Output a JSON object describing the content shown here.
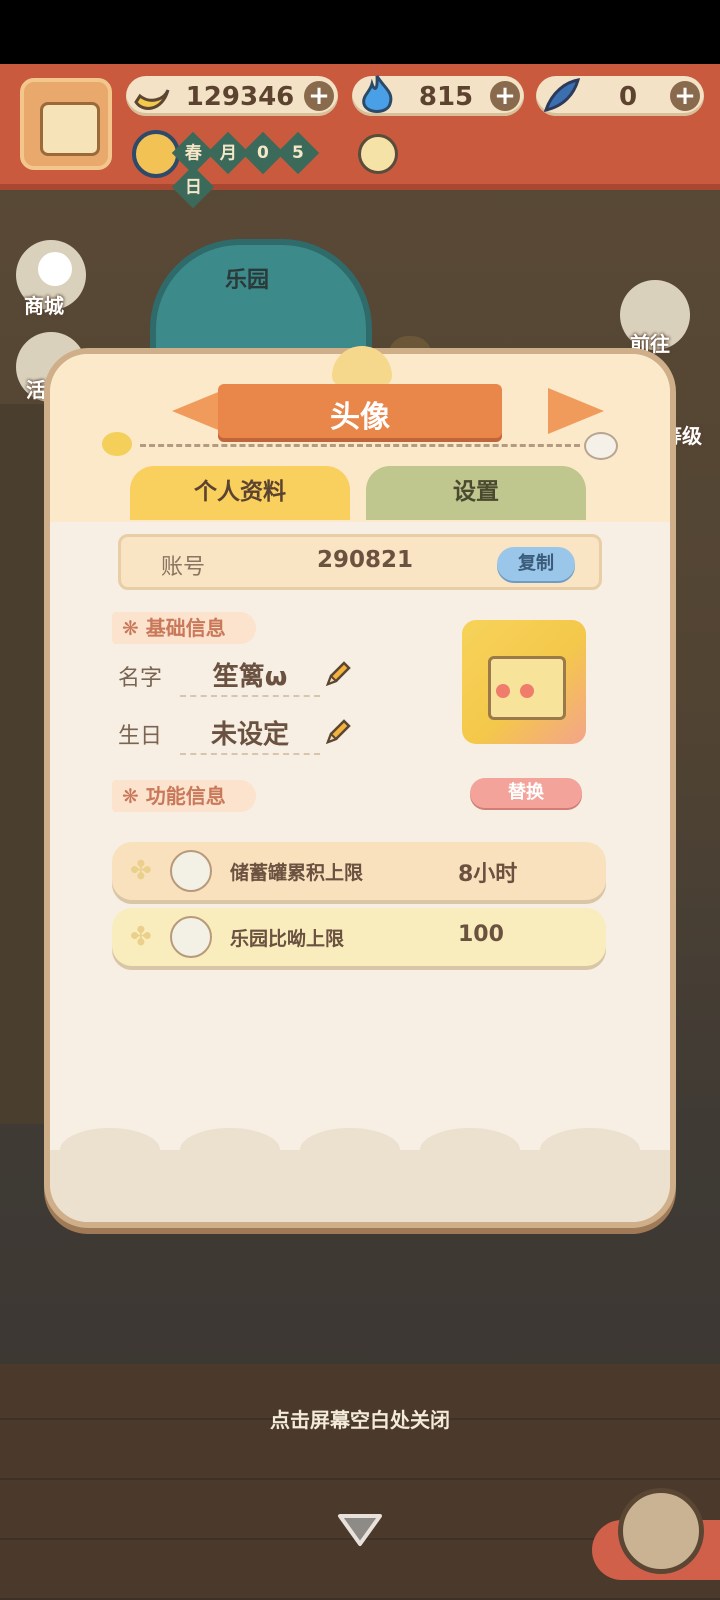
{
  "hud": {
    "bananas": "129346",
    "flames": "815",
    "feathers": "0",
    "date_cells": [
      "春",
      "月",
      "0",
      "5",
      "日"
    ]
  },
  "side_menu": {
    "shop": "商城",
    "activity": "活",
    "goto": "前往",
    "level": "等级"
  },
  "scene": {
    "gate_label": "乐园"
  },
  "modal": {
    "title": "头像",
    "tabs": [
      "个人资料",
      "设置"
    ],
    "account_label": "账号",
    "account_number": "290821",
    "copy_button": "复制",
    "basic_info_header": "基础信息",
    "name_label": "名字",
    "name_value": "笙篱ω",
    "birthday_label": "生日",
    "birthday_value": "未设定",
    "feature_info_header": "功能信息",
    "replace_button": "替换",
    "stats": [
      {
        "name": "储蓄罐累积上限",
        "value": "8小时"
      },
      {
        "name": "乐园比呦上限",
        "value": "100"
      }
    ]
  },
  "close_hint": "点击屏幕空白处关闭",
  "colors": {
    "accent": "#e9874a",
    "tab_active": "#f9cf5d",
    "tab_inactive": "#bfc68e",
    "copy_button": "#9ac6ea",
    "replace_button": "#f3a39a"
  },
  "icons": {
    "resource_1": "banana-icon",
    "resource_2": "blue-flame-icon",
    "resource_3": "feather-icon",
    "edit": "pencil-icon",
    "season": "clock-icon",
    "night": "moon-icon"
  }
}
